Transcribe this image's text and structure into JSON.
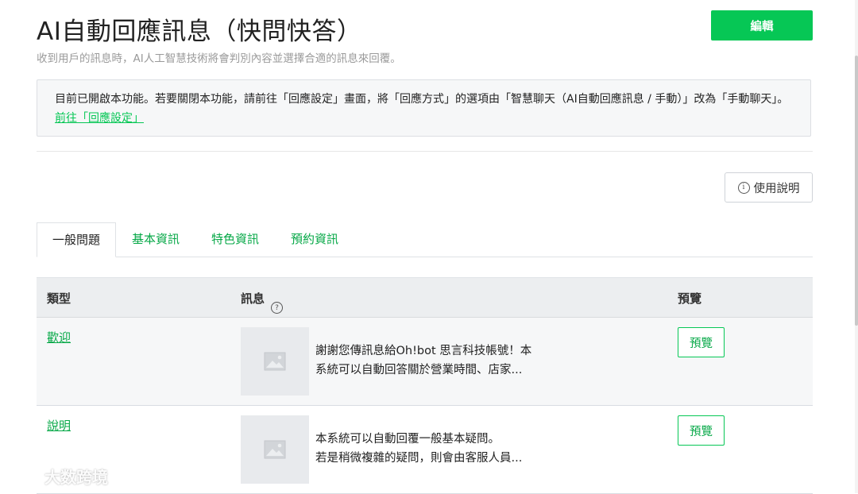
{
  "header": {
    "title": "AI自動回應訊息（快問快答）",
    "subtitle": "收到用戶的訊息時，AI人工智慧技術將會判別內容並選擇合適的訊息來回覆。",
    "edit_label": "編輯"
  },
  "notice": {
    "text": "目前已開啟本功能。若要關閉本功能，請前往「回應設定」畫面，將「回應方式」的選項由「智慧聊天（AI自動回應訊息 / 手動）」改為「手動聊天」。",
    "link_label": "前往「回應設定」"
  },
  "help_label": "使用說明",
  "tabs": [
    {
      "label": "一般問題",
      "active": true
    },
    {
      "label": "基本資訊",
      "active": false
    },
    {
      "label": "特色資訊",
      "active": false
    },
    {
      "label": "預約資訊",
      "active": false
    }
  ],
  "table": {
    "headers": {
      "type": "類型",
      "message": "訊息",
      "preview": "預覽"
    },
    "rows": [
      {
        "type": "歡迎",
        "message_line1": "謝謝您傳訊息給Oh!bot 思言科技帳號！本",
        "message_line2": "系統可以自動回答關於營業時間、店家...",
        "preview_label": "預覽"
      },
      {
        "type": "說明",
        "message_line1": "本系統可以自動回覆一般基本疑問。",
        "message_line2": "若是稍微複雜的疑問，則會由客服人員...",
        "preview_label": "預覽"
      }
    ]
  },
  "watermark": "大数跨境",
  "colors": {
    "accent": "#06c755",
    "link": "#06a847"
  }
}
